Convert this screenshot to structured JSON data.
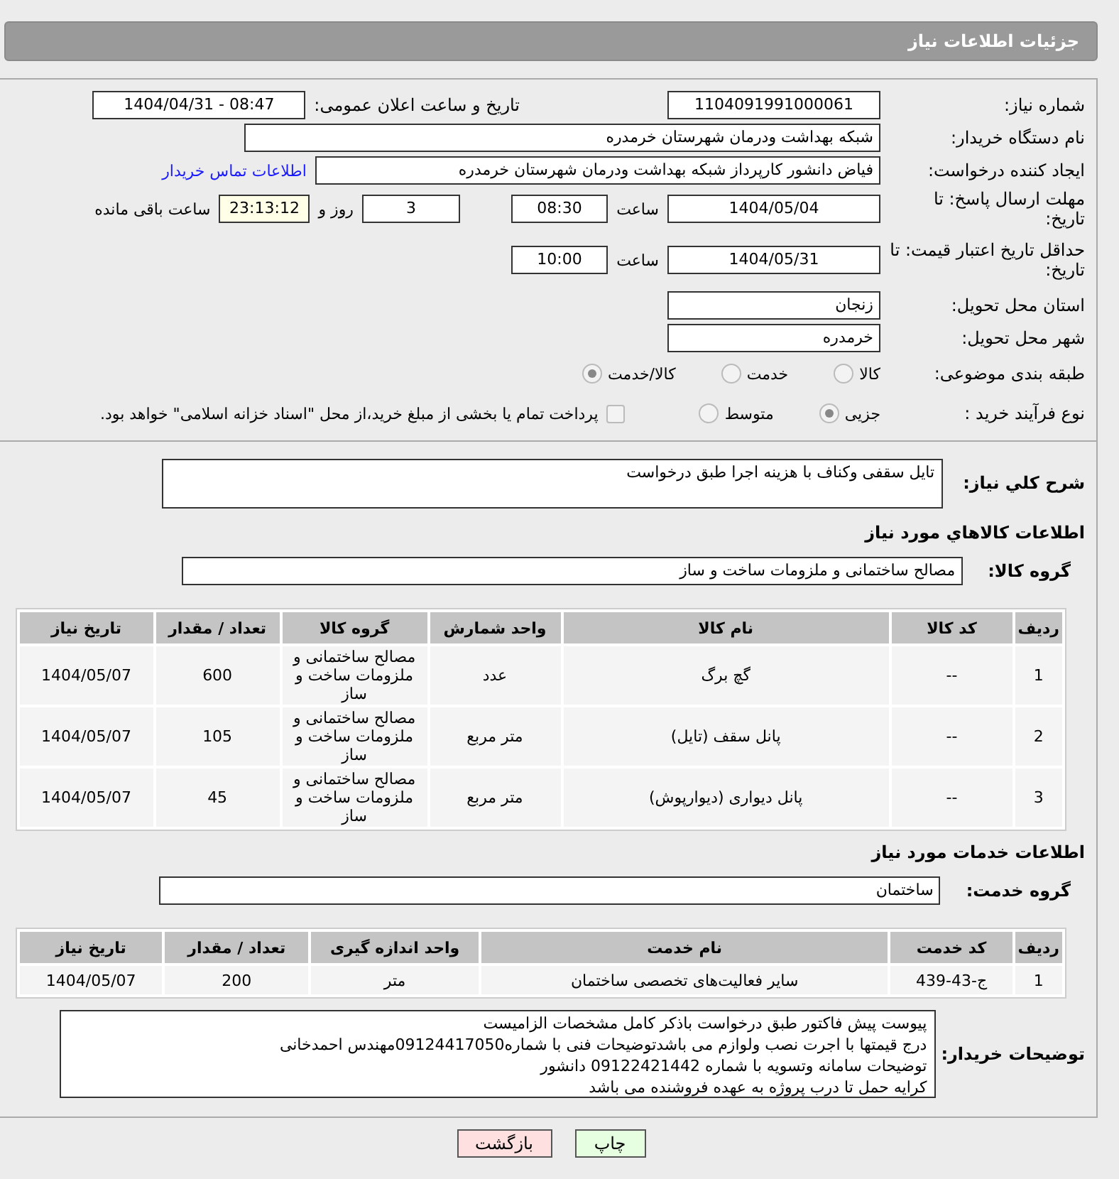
{
  "header": {
    "title": "جزئیات اطلاعات نیاز"
  },
  "form": {
    "need_number": {
      "label": "شماره نیاز:",
      "value": "1104091991000061"
    },
    "announce": {
      "label": "تاریخ و ساعت اعلان عمومی:",
      "value": "1404/04/31 - 08:47"
    },
    "buyer_org": {
      "label": "نام دستگاه خریدار:",
      "value": "شبکه بهداشت ودرمان شهرستان خرمدره"
    },
    "requester": {
      "label": "ایجاد کننده درخواست:",
      "value": "فیاض دانشور کارپرداز شبکه بهداشت ودرمان شهرستان خرمدره",
      "link": "اطلاعات تماس خریدار"
    },
    "deadline": {
      "label": "مهلت ارسال پاسخ: تا تاریخ:",
      "date": "1404/05/04",
      "time_label": "ساعت",
      "time": "08:30",
      "days": "3",
      "days_label": "روز و",
      "remaining": "23:13:12",
      "remaining_label": "ساعت باقی مانده"
    },
    "validity": {
      "label": "حداقل تاریخ اعتبار قیمت: تا تاریخ:",
      "date": "1404/05/31",
      "time_label": "ساعت",
      "time": "10:00"
    },
    "province": {
      "label": "استان محل تحویل:",
      "value": "زنجان"
    },
    "city": {
      "label": "شهر محل تحویل:",
      "value": "خرمدره"
    },
    "category": {
      "label": "طبقه بندی موضوعی:",
      "options": [
        {
          "label": "کالا",
          "selected": false
        },
        {
          "label": "خدمت",
          "selected": false
        },
        {
          "label": "کالا/خدمت",
          "selected": true
        }
      ]
    },
    "process": {
      "label": "نوع فرآیند خرید :",
      "options": [
        {
          "label": "جزیی",
          "selected": true
        },
        {
          "label": "متوسط",
          "selected": false
        }
      ],
      "payment": {
        "label": "پرداخت تمام یا بخشی از مبلغ خرید،از محل \"اسناد خزانه اسلامی\" خواهد بود.",
        "checked": false
      }
    },
    "description": {
      "label": "شرح کلي نياز:",
      "value": "تایل سقفی وکناف با هزینه اجرا طبق درخواست"
    }
  },
  "goods": {
    "title": "اطلاعات کالاهاي مورد نياز",
    "group": {
      "label": "گروه کالا:",
      "value": "مصالح ساختمانی و ملزومات ساخت و ساز"
    },
    "table": {
      "columns": [
        "ردیف",
        "کد کالا",
        "نام کالا",
        "واحد شمارش",
        "گروه کالا",
        "تعداد / مقدار",
        "تاریخ نیاز"
      ],
      "rows": [
        [
          "1",
          "--",
          "گچ برگ",
          "عدد",
          "مصالح ساختمانی و ملزومات ساخت و ساز",
          "600",
          "1404/05/07"
        ],
        [
          "2",
          "--",
          "پانل سقف (تایل)",
          "متر مربع",
          "مصالح ساختمانی و ملزومات ساخت و ساز",
          "105",
          "1404/05/07"
        ],
        [
          "3",
          "--",
          "پانل دیواری (دیوارپوش)",
          "متر مربع",
          "مصالح ساختمانی و ملزومات ساخت و ساز",
          "45",
          "1404/05/07"
        ]
      ]
    }
  },
  "services": {
    "title": "اطلاعات خدمات مورد نیاز",
    "group": {
      "label": "گروه خدمت:",
      "value": "ساختمان"
    },
    "table": {
      "columns": [
        "ردیف",
        "کد خدمت",
        "نام خدمت",
        "واحد اندازه گیری",
        "تعداد / مقدار",
        "تاریخ نیاز"
      ],
      "rows": [
        [
          "1",
          "ج-43-439",
          "سایر فعالیت‌های تخصصی ساختمان",
          "متر",
          "200",
          "1404/05/07"
        ]
      ]
    }
  },
  "notes": {
    "label": "توضیحات خریدار:",
    "lines": [
      "پیوست پیش فاکتور طبق درخواست باذکر کامل مشخصات الزامیست",
      "درج قیمتها با اجرت نصب ولوازم می باشدتوضیحات فنی با شماره09124417050مهندس احمدخانی",
      "توضیحات سامانه وتسویه با شماره 09122421442 دانشور",
      "کرایه حمل تا درب پروژه به عهده فروشنده می باشد"
    ]
  },
  "buttons": [
    {
      "label": "چاپ",
      "kind": "print"
    },
    {
      "label": "بازگشت",
      "kind": "back"
    }
  ]
}
